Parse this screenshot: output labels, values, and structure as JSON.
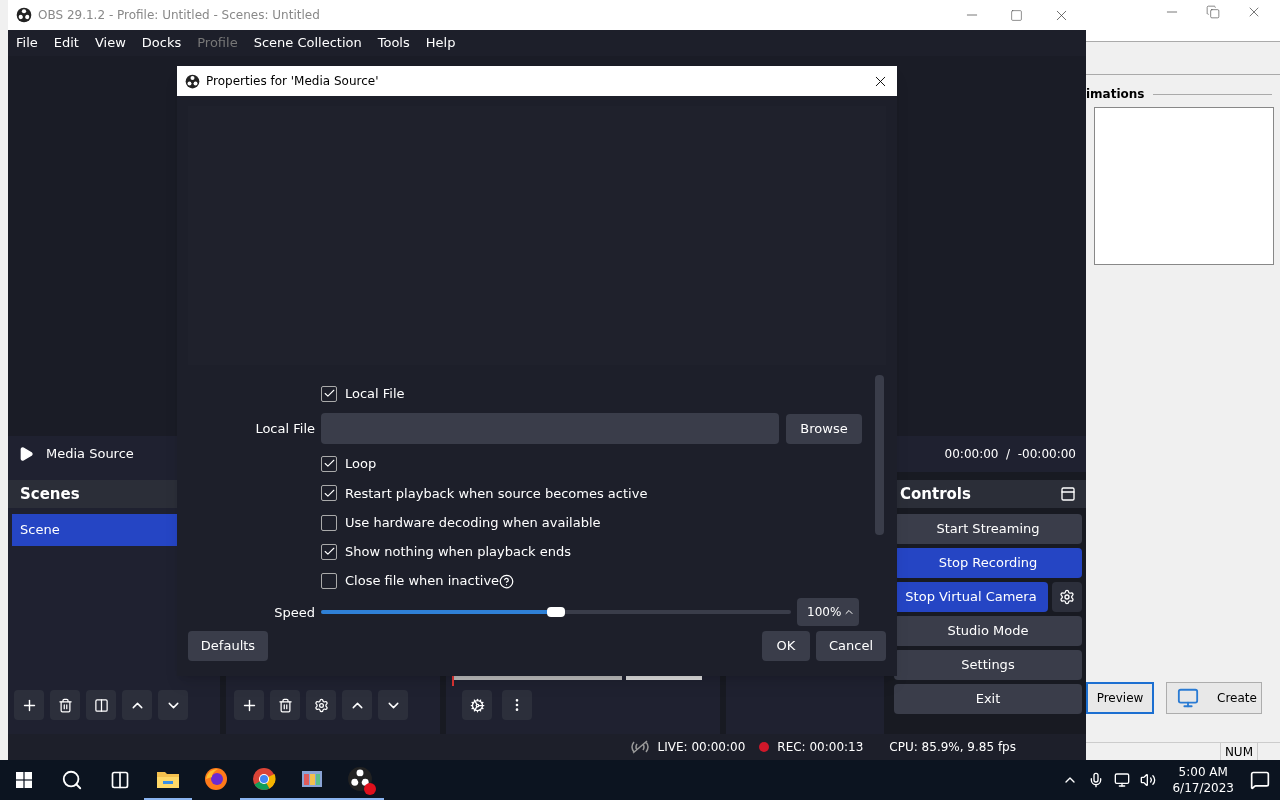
{
  "back_window": {
    "group_label": "imations",
    "buttons": [
      {
        "label": "Preview",
        "selected": true
      },
      {
        "label": "Create",
        "selected": false
      }
    ],
    "status": "NUM"
  },
  "obs": {
    "title": "OBS 29.1.2 - Profile: Untitled - Scenes: Untitled",
    "menu": [
      {
        "label": "File",
        "disabled": false
      },
      {
        "label": "Edit",
        "disabled": false
      },
      {
        "label": "View",
        "disabled": false
      },
      {
        "label": "Docks",
        "disabled": false
      },
      {
        "label": "Profile",
        "disabled": true
      },
      {
        "label": "Scene Collection",
        "disabled": false
      },
      {
        "label": "Tools",
        "disabled": false
      },
      {
        "label": "Help",
        "disabled": false
      }
    ],
    "media_bar": {
      "source": "Media Source",
      "time": "00:00:00  /  -00:00:00"
    },
    "scenes": {
      "title": "Scenes",
      "items": [
        {
          "label": "Scene",
          "selected": true
        }
      ]
    },
    "controls": {
      "title": "Controls",
      "buttons": [
        {
          "label": "Start Streaming",
          "active": false
        },
        {
          "label": "Stop Recording",
          "active": true
        },
        {
          "label": "Stop Virtual Camera",
          "active": true,
          "kind": "camera"
        },
        {
          "label": "Studio Mode",
          "active": false
        },
        {
          "label": "Settings",
          "active": false
        },
        {
          "label": "Exit",
          "active": false
        }
      ]
    },
    "status": {
      "live": "LIVE: 00:00:00",
      "rec": "REC: 00:00:13",
      "cpu": "CPU: 85.9%, 9.85 fps"
    }
  },
  "dialog": {
    "title": "Properties for 'Media Source'",
    "properties": [
      {
        "kind": "checkbox",
        "label": "Local File",
        "checked": true
      },
      {
        "kind": "file",
        "label": "Local File",
        "button": "Browse"
      },
      {
        "kind": "checkbox",
        "label": "Loop",
        "checked": true
      },
      {
        "kind": "checkbox",
        "label": "Restart playback when source becomes active",
        "checked": true
      },
      {
        "kind": "checkbox",
        "label": "Use hardware decoding when available",
        "checked": false
      },
      {
        "kind": "checkbox",
        "label": "Show nothing when playback ends",
        "checked": true
      },
      {
        "kind": "checkbox",
        "label": "Close file when inactive",
        "checked": false,
        "help": true
      },
      {
        "kind": "slider",
        "label": "Speed",
        "level": 0.5,
        "reading": "100%"
      }
    ],
    "defaults": "Defaults",
    "ok": "OK",
    "cancel": "Cancel"
  },
  "taskbar": {
    "apps": [
      {
        "kind": "folder",
        "running": true
      },
      {
        "kind": "firefox",
        "running": false
      },
      {
        "kind": "chrome",
        "running": true
      },
      {
        "kind": "gallery",
        "running": true
      },
      {
        "kind": "obs",
        "running": true
      }
    ],
    "time": "5:00 AM",
    "date": "6/17/2023"
  }
}
